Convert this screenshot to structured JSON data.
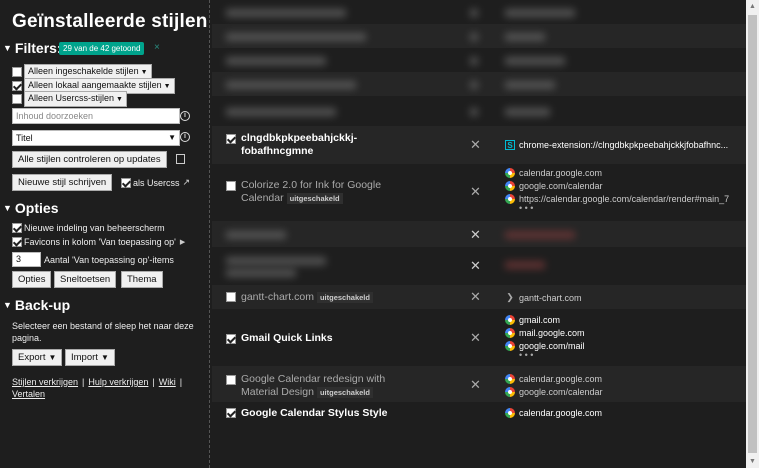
{
  "sidebar": {
    "title": "Geïnstalleerde stijlen",
    "filters": {
      "heading": "Filters:",
      "badge": "29 van de 42 getoond",
      "clear": "×",
      "items": [
        {
          "label": "Alleen ingeschakelde stijlen",
          "checked": false
        },
        {
          "label": "Alleen lokaal aangemaakte stijlen",
          "checked": true
        },
        {
          "label": "Alleen Usercss-stijlen",
          "checked": false
        }
      ],
      "search_placeholder": "Inhoud doorzoeken",
      "sort_value": "Titel",
      "check_updates": "Alle stijlen controleren op updates",
      "new_style": "Nieuwe stijl schrijven",
      "as_usercss": "als Usercss"
    },
    "options": {
      "heading": "Opties",
      "items": [
        {
          "label": "Nieuwe indeling van beheerscherm",
          "checked": true
        },
        {
          "label": "Favicons in kolom 'Van toepassing op'",
          "checked": true
        }
      ],
      "applies_count_value": "3",
      "applies_count_label": "Aantal 'Van toepassing op'-items",
      "buttons": [
        "Opties",
        "Sneltoetsen",
        "Thema"
      ]
    },
    "backup": {
      "heading": "Back-up",
      "text": "Selecteer een bestand of sleep het naar deze pagina.",
      "export": "Export",
      "import": "Import"
    },
    "links": [
      "Stijlen verkrijgen",
      "Hulp verkrijgen",
      "Wiki",
      "Vertalen"
    ],
    "link_sep": "|"
  },
  "styles": [
    {
      "name": "clngdbkpkpeebahjckkj-fobafhncgmne",
      "enabled": true,
      "tag": "",
      "apps": [
        {
          "icon": "stylus-icon",
          "text": "chrome-extension://clngdbkpkpeebahjckkjfobafhnc..."
        }
      ],
      "more": false
    },
    {
      "name": "Colorize 2.0 for Ink for Google Calendar",
      "enabled": false,
      "tag": "uitgeschakeld",
      "apps": [
        {
          "icon": "google-icon",
          "text": "calendar.google.com"
        },
        {
          "icon": "google-icon",
          "text": "google.com/calendar"
        },
        {
          "icon": "google-icon",
          "text": "https://calendar.google.com/calendar/render#main_7"
        }
      ],
      "more": true
    },
    {
      "name": "gantt-chart.com",
      "enabled": false,
      "tag": "uitgeschakeld",
      "apps": [
        {
          "icon": "chevron-icon",
          "text": "gantt-chart.com"
        }
      ],
      "more": false
    },
    {
      "name": "Gmail Quick Links",
      "enabled": true,
      "tag": "",
      "apps": [
        {
          "icon": "google-icon",
          "text": "gmail.com"
        },
        {
          "icon": "google-icon",
          "text": "mail.google.com"
        },
        {
          "icon": "google-icon",
          "text": "google.com/mail"
        }
      ],
      "more": true
    },
    {
      "name": "Google Calendar redesign with Material Design",
      "enabled": false,
      "tag": "uitgeschakeld",
      "apps": [
        {
          "icon": "google-icon",
          "text": "calendar.google.com"
        },
        {
          "icon": "google-icon",
          "text": "google.com/calendar"
        }
      ],
      "more": false
    },
    {
      "name": "Google Calendar Stylus Style",
      "enabled": true,
      "tag": "",
      "apps": [
        {
          "icon": "google-icon",
          "text": "calendar.google.com"
        }
      ],
      "more": false
    }
  ],
  "delete_glyph": "✕",
  "more_glyph": "• • •",
  "colors": {
    "accent": "#00a38c",
    "background": "#1e1e1e",
    "row_alt": "#262626"
  }
}
